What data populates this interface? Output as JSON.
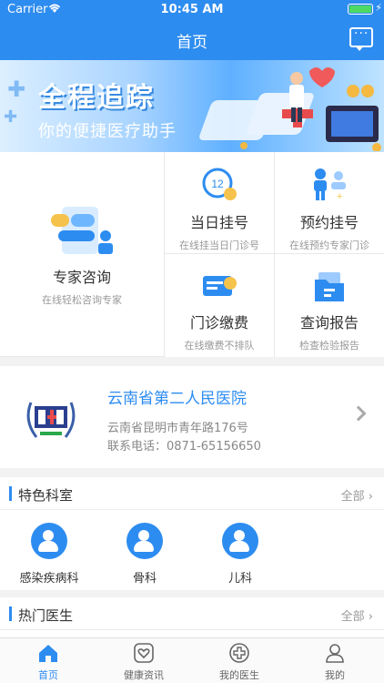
{
  "status": {
    "carrier": "Carrier",
    "time": "10:45 AM"
  },
  "nav": {
    "title": "首页",
    "message_icon": "chat-bubble-icon"
  },
  "banner": {
    "headline": "全程追踪",
    "subtitle": "你的便捷医疗助手"
  },
  "services": {
    "consult": {
      "label": "专家咨询",
      "sub": "在线轻松咨询专家"
    },
    "same_day": {
      "label": "当日挂号",
      "sub": "在线挂当日门诊号"
    },
    "appointment": {
      "label": "预约挂号",
      "sub": "在线预约专家门诊"
    },
    "payment": {
      "label": "门诊缴费",
      "sub": "在线缴费不排队"
    },
    "report": {
      "label": "查询报告",
      "sub": "检查检验报告"
    }
  },
  "hospital": {
    "name": "云南省第二人民医院",
    "address": "云南省昆明市青年路176号",
    "phone": "联系电话：0871-65156650"
  },
  "departments": {
    "title": "特色科室",
    "all": "全部 ›",
    "items": [
      {
        "label": "感染疾病科"
      },
      {
        "label": "骨科"
      },
      {
        "label": "儿科"
      }
    ]
  },
  "doctors": {
    "title": "热门医生",
    "all": "全部 ›"
  },
  "tabs": [
    {
      "label": "首页"
    },
    {
      "label": "健康资讯"
    },
    {
      "label": "我的医生"
    },
    {
      "label": "我的"
    }
  ],
  "colors": {
    "primary": "#2d8cf0",
    "background": "#f2f2f2"
  }
}
